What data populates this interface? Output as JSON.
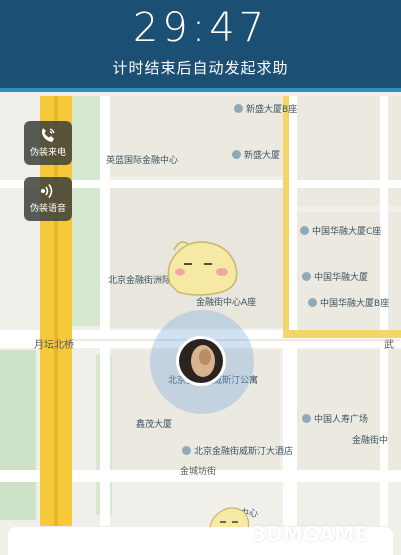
{
  "header": {
    "timer": "29:47",
    "subtitle": "计时结束后自动发起求助"
  },
  "side_buttons": [
    {
      "label": "伪装来电",
      "icon": "phone-ring-icon"
    },
    {
      "label": "伪装语音",
      "icon": "voice-icon"
    }
  ],
  "map": {
    "pois": [
      {
        "name": "新盛大厦B座"
      },
      {
        "name": "英蓝国际金融中心"
      },
      {
        "name": "新盛大厦"
      },
      {
        "name": "中国华融大厦C座"
      },
      {
        "name": "北京金融街洲际酒店"
      },
      {
        "name": "中国华融大厦"
      },
      {
        "name": "金融街中心A座"
      },
      {
        "name": "中国华融大厦B座"
      },
      {
        "name": "北京金融街威斯汀公寓"
      },
      {
        "name": "鑫茂大厦"
      },
      {
        "name": "中国人寿广场"
      },
      {
        "name": "北京金融街威斯汀大酒店"
      },
      {
        "name": "金融街中"
      },
      {
        "name": "金城坊街"
      },
      {
        "name": "金融中心"
      }
    ],
    "roads": {
      "north_bridge": "月坛北桥",
      "wu": "武",
      "wushu": "武定侯"
    }
  },
  "watermark": "3DMGAME",
  "colors": {
    "header": "#1b4f73",
    "accent": "#2f90bf",
    "road_main": "#f5c93a"
  }
}
